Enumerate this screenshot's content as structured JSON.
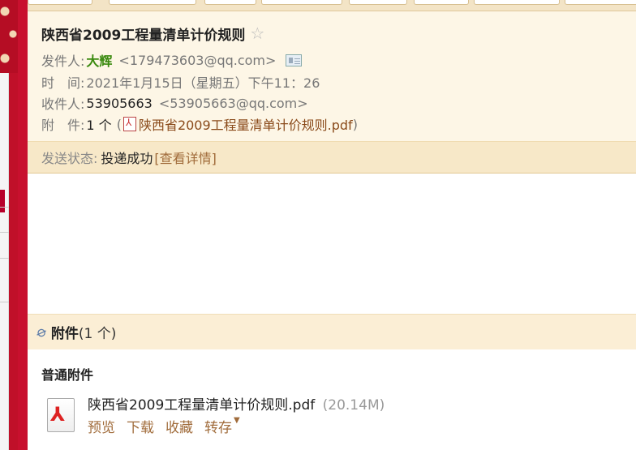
{
  "mail": {
    "subject": "陕西省2009工程量清单计价规则",
    "from_label": "发件人:",
    "from_name": "大辉",
    "from_addr": "<179473603@qq.com>",
    "time_label": "时　间:",
    "time_value": "2021年1月15日（星期五）下午11：26",
    "to_label": "收件人:",
    "to_name": "53905663",
    "to_addr": "<53905663@qq.com>",
    "att_label": "附　件:",
    "att_count": "1 个",
    "att_paren_open": "(",
    "att_paren_close": ")",
    "att_file": "陕西省2009工程量清单计价规则.pdf"
  },
  "status": {
    "label": "发送状态:",
    "value": "投递成功",
    "link": "[查看详情]"
  },
  "attachments": {
    "header_title": "附件",
    "header_count": "(1 个)",
    "section_label": "普通附件",
    "file": {
      "name": "陕西省2009工程量清单计价规则.pdf",
      "size": "(20.14M)",
      "actions": {
        "preview": "预览",
        "download": "下载",
        "collect": "收藏",
        "save_to": "转存"
      }
    }
  },
  "icons": {
    "star": "star-icon",
    "contact_card": "contact-card-icon",
    "pdf": "pdf-icon",
    "paperclip": "paperclip-icon",
    "dropdown": "caret-down-icon"
  },
  "colors": {
    "header_bg": "#fdf6e6",
    "status_bg": "#f7e8c8",
    "sender_name": "#3a8a0f",
    "link": "#a06b3a",
    "brand_red": "#c8102e"
  }
}
